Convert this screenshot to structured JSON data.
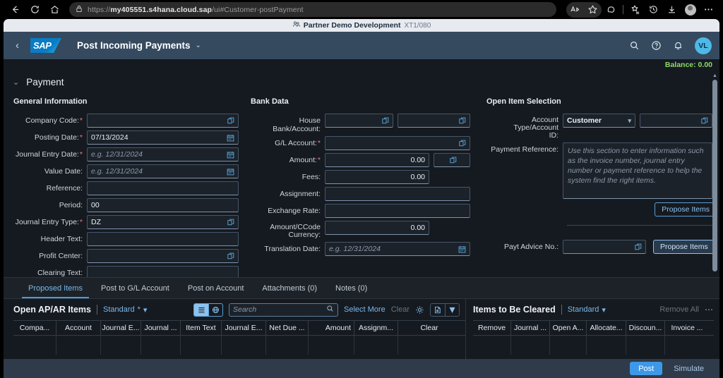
{
  "browser": {
    "url_prefix": "https://",
    "url_domain": "my405551.s4hana.cloud.sap",
    "url_path": "/ui#Customer-postPayment",
    "back_icon": "back-arrow-icon",
    "refresh_icon": "refresh-icon",
    "home_icon": "home-icon",
    "lock_icon": "lock-icon",
    "read_aloud_icon": "read-aloud-icon",
    "favorite_icon": "star-icon",
    "copilot_icon": "copilot-icon",
    "collections_icon": "collections-icon",
    "history_icon": "history-icon",
    "downloads_icon": "download-icon",
    "profile_icon": "profile-avatar-icon",
    "settings_icon": "more-options-icon"
  },
  "tenant": {
    "icon": "people-group-icon",
    "title": "Partner Demo Development",
    "system": "XT1/080"
  },
  "shellbar": {
    "back_label": "‹",
    "logo_text": "SAP",
    "app_title": "Post Incoming Payments",
    "title_chevron": "⌄",
    "search_icon": "search-icon",
    "help_icon": "help-icon",
    "notifications_icon": "bell-icon",
    "avatar_initials": "VL"
  },
  "balance": {
    "label": "Balance: 0.00",
    "color": "#8fd96a"
  },
  "section": {
    "chevron": "⌄",
    "title": "Payment"
  },
  "general_information": {
    "group_title": "General Information",
    "fields": [
      {
        "label": "Company Code:",
        "required": true,
        "value": "",
        "placeholder": "",
        "icon": "value-help-icon"
      },
      {
        "label": "Posting Date:",
        "required": true,
        "value": "07/13/2024",
        "placeholder": "",
        "icon": "calendar-icon"
      },
      {
        "label": "Journal Entry Date:",
        "required": true,
        "value": "",
        "placeholder": "e.g. 12/31/2024",
        "icon": "calendar-icon"
      },
      {
        "label": "Value Date:",
        "required": false,
        "value": "",
        "placeholder": "e.g. 12/31/2024",
        "icon": "calendar-icon"
      },
      {
        "label": "Reference:",
        "required": false,
        "value": "",
        "placeholder": "",
        "icon": ""
      },
      {
        "label": "Period:",
        "required": false,
        "value": "00",
        "placeholder": "",
        "icon": ""
      },
      {
        "label": "Journal Entry Type:",
        "required": true,
        "value": "DZ",
        "placeholder": "",
        "icon": "value-help-icon"
      },
      {
        "label": "Header Text:",
        "required": false,
        "value": "",
        "placeholder": "",
        "icon": ""
      },
      {
        "label": "Profit Center:",
        "required": false,
        "value": "",
        "placeholder": "",
        "icon": "value-help-icon"
      },
      {
        "label": "Clearing Text:",
        "required": false,
        "value": "",
        "placeholder": "",
        "icon": ""
      }
    ]
  },
  "bank_data": {
    "group_title": "Bank Data",
    "fields": [
      {
        "label": "House Bank/Account:",
        "required": false,
        "value": "",
        "placeholder": "",
        "icon": "value-help-icon"
      },
      {
        "label": "G/L Account:",
        "required": true,
        "value": "",
        "placeholder": "",
        "icon": "value-help-icon"
      },
      {
        "label": "Amount:",
        "required": true,
        "value": "0.00",
        "placeholder": "",
        "icon": "value-help-icon"
      },
      {
        "label": "Fees:",
        "required": false,
        "value": "0.00",
        "placeholder": "",
        "icon": ""
      },
      {
        "label": "Assignment:",
        "required": false,
        "value": "",
        "placeholder": "",
        "icon": ""
      },
      {
        "label": "Exchange Rate:",
        "required": false,
        "value": "",
        "placeholder": "",
        "icon": ""
      },
      {
        "label": "Amount/CCode Currency:",
        "required": false,
        "value": "0.00",
        "placeholder": "",
        "icon": ""
      },
      {
        "label": "Translation Date:",
        "required": false,
        "value": "",
        "placeholder": "e.g. 12/31/2024",
        "icon": "calendar-icon"
      }
    ]
  },
  "open_item_selection": {
    "group_title": "Open Item Selection",
    "account_type_label": "Account Type/Account ID:",
    "account_type_value": "Customer",
    "account_type_options": [
      "Customer"
    ],
    "account_id_value": "",
    "payment_reference_label": "Payment Reference:",
    "payment_reference_placeholder": "Use this section to enter information such as the invoice number, journal entry number or payment reference to help the system find the right items.",
    "propose_items_label": "Propose Items",
    "payt_advice_label": "Payt Advice No.:",
    "payt_advice_value": "",
    "propose_items_2_label": "Propose Items"
  },
  "tabs": [
    {
      "label": "Proposed Items",
      "active": true
    },
    {
      "label": "Post to G/L Account",
      "active": false
    },
    {
      "label": "Post on Account",
      "active": false
    },
    {
      "label": "Attachments (0)",
      "active": false
    },
    {
      "label": "Notes (0)",
      "active": false
    }
  ],
  "open_items_panel": {
    "title": "Open AP/AR Items",
    "variant": "Standard",
    "variant_modified_marker": "*",
    "view_list_icon": "list-view-icon",
    "view_globe_icon": "globe-view-icon",
    "search_placeholder": "Search",
    "search_icon": "search-icon",
    "select_more_label": "Select More",
    "clear_label": "Clear",
    "clear_disabled": true,
    "settings_icon": "gear-icon",
    "export_icon": "export-spreadsheet-icon",
    "export_menu_icon": "chevron-down-icon",
    "columns": [
      "Compa...",
      "Account",
      "Journal E...",
      "Journal ...",
      "Item Text",
      "Journal E...",
      "Net Due ...",
      "Amount",
      "Assignm...",
      "Clear"
    ],
    "rows": []
  },
  "items_cleared_panel": {
    "title": "Items to Be Cleared",
    "variant": "Standard",
    "remove_all_label": "Remove All",
    "remove_all_disabled": true,
    "overflow_icon": "more-options-icon",
    "columns": [
      "Remove",
      "Journal ...",
      "Open A...",
      "Allocate...",
      "Discoun...",
      "Invoice ..."
    ],
    "rows": []
  },
  "footer": {
    "post_label": "Post",
    "simulate_label": "Simulate"
  }
}
